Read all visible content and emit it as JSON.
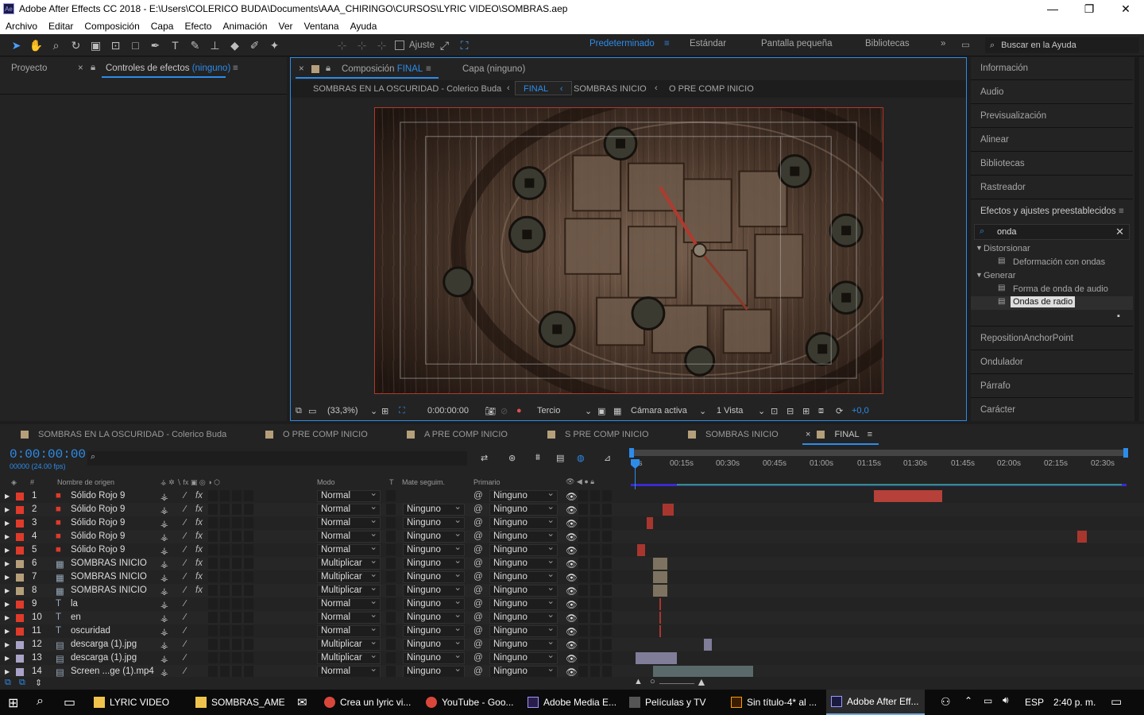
{
  "window": {
    "title": "Adobe After Effects CC 2018 - E:\\Users\\COLERICO BUDA\\Documents\\AAA_CHIRINGO\\CURSOS\\LYRIC VIDEO\\SOMBRAS.aep",
    "app_badge": "Ae"
  },
  "menu": [
    "Archivo",
    "Editar",
    "Composición",
    "Capa",
    "Efecto",
    "Animación",
    "Ver",
    "Ventana",
    "Ayuda"
  ],
  "toolbar": {
    "snap_label": "Ajuste",
    "workspaces": [
      "Predeterminado",
      "Estándar",
      "Pantalla pequeña",
      "Bibliotecas"
    ],
    "active_workspace": "Predeterminado",
    "search_placeholder": "Buscar en la Ayuda"
  },
  "left_panel": {
    "tab_project": "Proyecto",
    "tab_effects": "Controles de efectos",
    "tab_effects_value": "(ninguno)"
  },
  "comp_panel": {
    "tab_label": "Composición",
    "tab_value": "FINAL",
    "layer_tab": "Capa (ninguno)",
    "breadcrumbs": [
      "SOMBRAS EN LA OSCURIDAD  - Colerico Buda",
      "FINAL",
      "SOMBRAS INICIO",
      "O PRE COMP INICIO"
    ],
    "footer": {
      "zoom": "(33,3%)",
      "timecode": "0:00:00:00",
      "resolution": "Tercio",
      "camera": "Cámara activa",
      "views": "1 Vista",
      "exposure": "+0,0"
    }
  },
  "right_panel": {
    "items": [
      "Información",
      "Audio",
      "Previsualización",
      "Alinear",
      "Bibliotecas",
      "Rastreador",
      "Efectos y ajustes preestablecidos"
    ],
    "search_value": "onda",
    "tree": [
      {
        "group": "Distorsionar",
        "items": [
          "Deformación con ondas"
        ]
      },
      {
        "group": "Generar",
        "items": [
          "Forma de onda de audio",
          "Ondas de radio"
        ]
      }
    ],
    "lower_items": [
      "RepositionAnchorPoint",
      "Ondulador",
      "Párrafo",
      "Carácter"
    ]
  },
  "timeline": {
    "tabs": [
      "SOMBRAS EN LA OSCURIDAD  - Colerico Buda",
      "O PRE COMP INICIO",
      "A PRE COMP INICIO",
      "S PRE COMP INICIO",
      "SOMBRAS INICIO",
      "FINAL"
    ],
    "timecode": "0:00:00:00",
    "fps": "00000 (24.00 fps)",
    "ruler": [
      "0s",
      "00:15s",
      "00:30s",
      "00:45s",
      "01:00s",
      "01:15s",
      "01:30s",
      "01:45s",
      "02:00s",
      "02:15s",
      "02:30s"
    ],
    "headers": {
      "num": "#",
      "source": "Nombre de origen",
      "mode": "Modo",
      "t": "T",
      "matte": "Mate seguim.",
      "parent": "Primario"
    },
    "layers": [
      {
        "n": "1",
        "name": "Sólido Rojo 9",
        "color": "#e03a2a",
        "icon": "solid",
        "mode": "Normal",
        "matte": "",
        "parent": "Ninguno"
      },
      {
        "n": "2",
        "name": "Sólido Rojo 9",
        "color": "#e03a2a",
        "icon": "solid",
        "mode": "Normal",
        "matte": "Ninguno",
        "parent": "Ninguno"
      },
      {
        "n": "3",
        "name": "Sólido Rojo 9",
        "color": "#e03a2a",
        "icon": "solid",
        "mode": "Normal",
        "matte": "Ninguno",
        "parent": "Ninguno"
      },
      {
        "n": "4",
        "name": "Sólido Rojo 9",
        "color": "#e03a2a",
        "icon": "solid",
        "mode": "Normal",
        "matte": "Ninguno",
        "parent": "Ninguno"
      },
      {
        "n": "5",
        "name": "Sólido Rojo 9",
        "color": "#e03a2a",
        "icon": "solid",
        "mode": "Normal",
        "matte": "Ninguno",
        "parent": "Ninguno"
      },
      {
        "n": "6",
        "name": "SOMBRAS INICIO",
        "color": "#b59f7a",
        "icon": "comp",
        "mode": "Multiplicar",
        "matte": "Ninguno",
        "parent": "Ninguno"
      },
      {
        "n": "7",
        "name": "SOMBRAS INICIO",
        "color": "#b59f7a",
        "icon": "comp",
        "mode": "Multiplicar",
        "matte": "Ninguno",
        "parent": "Ninguno"
      },
      {
        "n": "8",
        "name": "SOMBRAS INICIO",
        "color": "#b59f7a",
        "icon": "comp",
        "mode": "Multiplicar",
        "matte": "Ninguno",
        "parent": "Ninguno"
      },
      {
        "n": "9",
        "name": "la",
        "color": "#e03a2a",
        "icon": "text",
        "mode": "Normal",
        "matte": "Ninguno",
        "parent": "Ninguno"
      },
      {
        "n": "10",
        "name": "en",
        "color": "#e03a2a",
        "icon": "text",
        "mode": "Normal",
        "matte": "Ninguno",
        "parent": "Ninguno"
      },
      {
        "n": "11",
        "name": "oscuridad",
        "color": "#e03a2a",
        "icon": "text",
        "mode": "Normal",
        "matte": "Ninguno",
        "parent": "Ninguno"
      },
      {
        "n": "12",
        "name": "descarga (1).jpg",
        "color": "#a9a3c8",
        "icon": "file",
        "mode": "Multiplicar",
        "matte": "Ninguno",
        "parent": "Ninguno"
      },
      {
        "n": "13",
        "name": "descarga (1).jpg",
        "color": "#a9a3c8",
        "icon": "file",
        "mode": "Multiplicar",
        "matte": "Ninguno",
        "parent": "Ninguno"
      },
      {
        "n": "14",
        "name": "Screen ...ge (1).mp4",
        "color": "#a9a3c8",
        "icon": "file",
        "mode": "Normal",
        "matte": "Ninguno",
        "parent": "Ninguno"
      }
    ]
  },
  "taskbar": {
    "items": [
      "LYRIC VIDEO",
      "SOMBRAS_AME",
      "Crea un lyric vi...",
      "YouTube - Goo...",
      "Adobe Media E...",
      "Películas y TV",
      "Sin título-4* al ...",
      "Adobe After Eff..."
    ],
    "lang": "ESP",
    "time": "2:40 p. m."
  }
}
